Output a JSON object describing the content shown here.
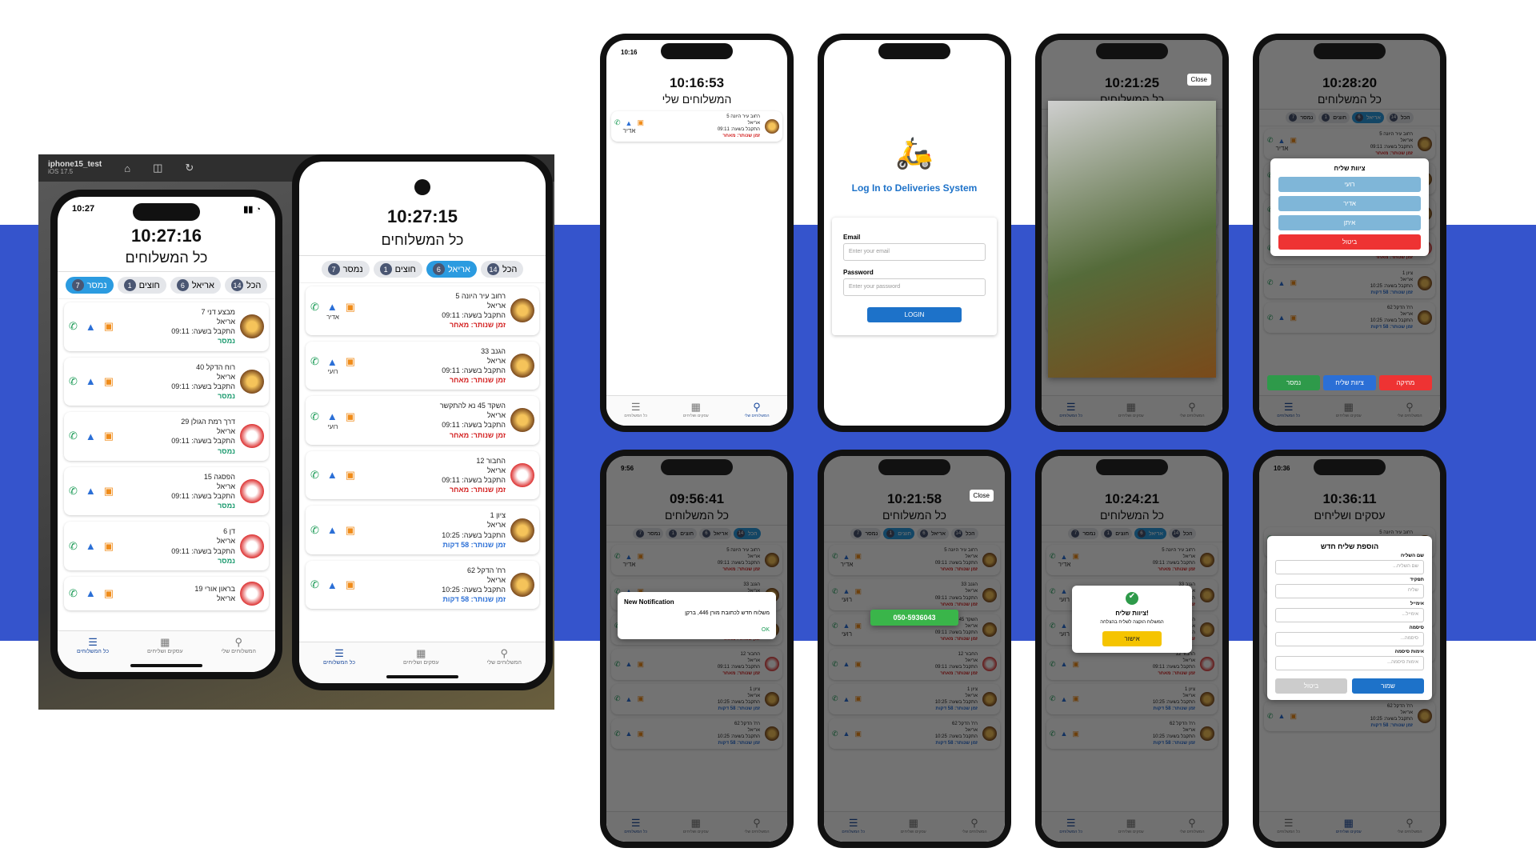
{
  "simulator": {
    "device": "iphone15_test",
    "os": "iOS 17.5"
  },
  "main": {
    "left": {
      "status_time": "10:27",
      "clock": "10:27:16",
      "title": "כל המשלוחים",
      "tabs": [
        {
          "label": "הכל",
          "count": "14"
        },
        {
          "label": "אריאל",
          "count": "6"
        },
        {
          "label": "חוצים",
          "count": "1"
        },
        {
          "label": "נמסר",
          "count": "7"
        }
      ],
      "cards": [
        {
          "addr": "מבצע דני 7",
          "name": "אריאל",
          "time": "התקבל בשעה: 09:11",
          "status": "נמסר",
          "logo": "brown"
        },
        {
          "addr": "רוח הדקל 40",
          "name": "אריאל",
          "time": "התקבל בשעה: 09:11",
          "status": "נמסר",
          "logo": "brown"
        },
        {
          "addr": "דרך רמת הגולן 29",
          "name": "אריאל",
          "time": "התקבל בשעה: 09:11",
          "status": "נמסר",
          "logo": "red"
        },
        {
          "addr": "הפסגה 15",
          "name": "אריאל",
          "time": "התקבל בשעה: 09:11",
          "status": "נמסר",
          "logo": "red"
        },
        {
          "addr": "דן 6",
          "name": "אריאל",
          "time": "התקבל בשעה: 09:11",
          "status": "נמסר",
          "logo": "red"
        },
        {
          "addr": "בראון אורי 19",
          "name": "אריאל",
          "time": "",
          "status": "",
          "logo": "red"
        }
      ]
    },
    "right": {
      "clock": "10:27:15",
      "title": "כל המשלוחים",
      "tabs": [
        {
          "label": "הכל",
          "count": "14"
        },
        {
          "label": "אריאל",
          "count": "6"
        },
        {
          "label": "חוצים",
          "count": "1"
        },
        {
          "label": "נמסר",
          "count": "7"
        }
      ],
      "cards": [
        {
          "addr": "רחוב עיר היונה 5",
          "name": "אריאל",
          "time": "התקבל בשעה: 09:11",
          "status": "זמן שנותר: מאחר",
          "courier": "אדיר",
          "logo": "brown"
        },
        {
          "addr": "הגנב 33",
          "name": "אריאל",
          "time": "התקבל בשעה: 09:11",
          "status": "זמן שנותר: מאחר",
          "courier": "רועי",
          "logo": "brown"
        },
        {
          "addr": "השקד 45 נא להתקשר",
          "name": "אריאל",
          "time": "התקבל בשעה: 09:11",
          "status": "זמן שנותר: מאחר",
          "courier": "רועי",
          "logo": "brown"
        },
        {
          "addr": "החבור 12",
          "name": "אריאל",
          "time": "התקבל בשעה: 09:11",
          "status": "זמן שנותר: מאחר",
          "courier": "",
          "logo": "red"
        },
        {
          "addr": "ציון 1",
          "name": "אריאל",
          "time": "התקבל בשעה: 10:25",
          "status": "זמן שנותר: 58 דקות",
          "courier": "",
          "logo": "brown"
        },
        {
          "addr": "רח' הדקל 62",
          "name": "אריאל",
          "time": "התקבל בשעה: 10:25",
          "status": "זמן שנותר: 58 דקות",
          "courier": "",
          "logo": "brown"
        }
      ]
    },
    "nav": [
      "כל המשלוחים",
      "עסקים ושליחים",
      "המשלוחים שלי"
    ]
  },
  "grid": [
    {
      "clock": "10:16:53",
      "title": "המשלוחים שלי",
      "status_time": "10:16"
    },
    {
      "login_title": "Log In to Deliveries System",
      "email_label": "Email",
      "email_ph": "Enter your email",
      "pw_label": "Password",
      "pw_ph": "Enter your password",
      "btn": "LOGIN"
    },
    {
      "clock": "10:21:25",
      "title": "כל המשלוחים",
      "close": "Close"
    },
    {
      "clock": "10:28:20",
      "title": "כל המשלוחים",
      "modal_title": "ציוות שליח",
      "options": [
        "רועי",
        "אדיר",
        "איתן"
      ],
      "cancel": "ביטול",
      "bottom": [
        "נמסר",
        "ציוות שליח",
        "מחיקה"
      ]
    },
    {
      "clock": "09:56:41",
      "title": "כל המשלוחים",
      "status_time": "9:56",
      "notif_title": "New Notification",
      "notif_body": "משלוח חדש לכתובת מורן 446, ברקן",
      "ok": "OK"
    },
    {
      "clock": "10:21:58",
      "title": "כל המשלוחים",
      "close": "Close",
      "phone": "050-5936043"
    },
    {
      "clock": "10:24:21",
      "title": "כל המשלוחים",
      "success_title": "ציוות שליח!",
      "success_body": "המשלוח הוקצה לשליח בהצלחה",
      "confirm": "אישור"
    },
    {
      "clock": "10:36:11",
      "title": "עסקים ושליחים",
      "status_time": "10:36",
      "form_title": "הוספת שליח חדש",
      "fields": [
        {
          "label": "שם השליח",
          "ph": "שם השליח..."
        },
        {
          "label": "תפקיד",
          "ph": "שליח"
        },
        {
          "label": "אימייל",
          "ph": "אימייל..."
        },
        {
          "label": "סיסמה",
          "ph": "סיסמה..."
        },
        {
          "label": "אימות סיסמה",
          "ph": "אימות סיסמה..."
        }
      ],
      "cancel": "ביטול",
      "save": "שמור"
    }
  ]
}
